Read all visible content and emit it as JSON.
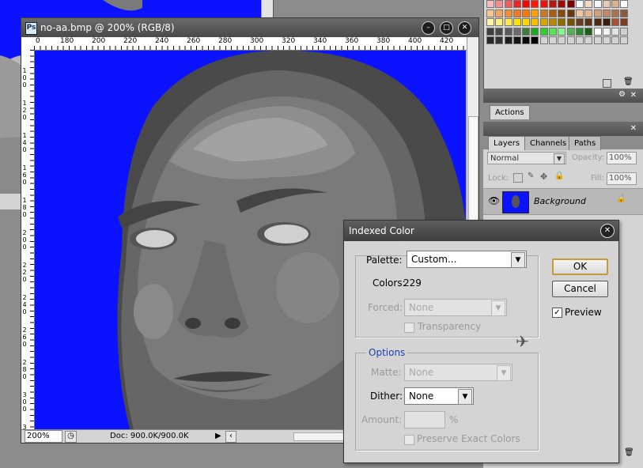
{
  "document_window": {
    "title": "no-aa.bmp @ 200% (RGB/8)",
    "ruler_h_ticks": [
      "0",
      "180",
      "200",
      "220",
      "240",
      "260",
      "280",
      "300",
      "320",
      "340",
      "360",
      "380",
      "400",
      "420"
    ],
    "ruler_v_ticks": [
      "100",
      "120",
      "140",
      "160",
      "180",
      "200",
      "220",
      "240",
      "260",
      "280",
      "300",
      "320"
    ],
    "zoom": "200%",
    "doc_info": "Doc: 900.0K/900.0K",
    "canvas_color": "#0a12ff"
  },
  "panels": {
    "actions_tab": "Actions",
    "layers_tabs": [
      "Layers",
      "Channels",
      "Paths"
    ],
    "blend_mode": "Normal",
    "opacity_label": "Opacity:",
    "opacity_value": "100%",
    "lock_label": "Lock:",
    "fill_label": "Fill:",
    "fill_value": "100%",
    "layer_name": "Background"
  },
  "dialog": {
    "title": "Indexed Color",
    "palette_label": "Palette:",
    "palette_value": "Custom...",
    "colors_label": "Colors:",
    "colors_value": "229",
    "forced_label": "Forced:",
    "forced_value": "None",
    "transparency_label": "Transparency",
    "options_legend": "Options",
    "matte_label": "Matte:",
    "matte_value": "None",
    "dither_label": "Dither:",
    "dither_value": "None",
    "amount_label": "Amount:",
    "amount_unit": "%",
    "preserve_label": "Preserve Exact Colors",
    "ok_label": "OK",
    "cancel_label": "Cancel",
    "preview_label": "Preview",
    "preview_checked": true
  },
  "swatch_colors": [
    "#f7bcbc",
    "#f58f8f",
    "#f25c5c",
    "#ee2424",
    "#ff0000",
    "#ff1a00",
    "#ee0e0e",
    "#c01010",
    "#a00a0a",
    "#800000",
    "#ffffff",
    "#f2d9c6",
    "#f5f5f5",
    "#e8c9b1",
    "#d7b293",
    "#ffffff",
    "#f7c78f",
    "#f6a55d",
    "#f58c2f",
    "#f2791d",
    "#ff7700",
    "#ffa000",
    "#c97a1e",
    "#b05c10",
    "#8a4a0a",
    "#6c3808",
    "#f1c7a0",
    "#e7b68e",
    "#d4a07a",
    "#c18a64",
    "#aa7450",
    "#8c5c3c",
    "#fff3a4",
    "#fff07a",
    "#ffe94a",
    "#ffe000",
    "#ffd800",
    "#f4c000",
    "#d9a400",
    "#b78700",
    "#906b00",
    "#725300",
    "#6a3c22",
    "#5e3219",
    "#4e2812",
    "#3c1d0c",
    "#a5532e",
    "#7d3d1e",
    "#3e3e3e",
    "#4a4a4a",
    "#5b5b5b",
    "#6b6b6b",
    "#3c7d3c",
    "#24a424",
    "#33cc33",
    "#56e656",
    "#8bf58b",
    "#51b451",
    "#2f8a2f",
    "#1b611b",
    "#ffffff",
    "#f4f4f4",
    "#e3e3e3",
    "#d0d0d0",
    "#2a2a2a",
    "#333333",
    "#1e1e1e",
    "#141414",
    "#0a0a0a",
    "#000000",
    "#d4d4d4",
    "#d4d4d4",
    "#d4d4d4",
    "#d4d4d4",
    "#d4d4d4",
    "#d4d4d4",
    "#d4d4d4",
    "#d4d4d4",
    "#d4d4d4",
    "#d4d4d4"
  ]
}
